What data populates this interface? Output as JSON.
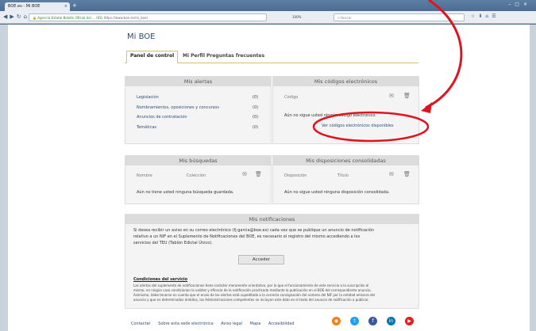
{
  "browser": {
    "tab_title": "BOE.es - Mi BOE",
    "new_tab": "+",
    "url_secure": "Agencia Estatal Boletín Oficial del ... (ES)",
    "url_text": "https://www.boe.es/mi_boe/",
    "zoom": "100%",
    "search_placeholder": "Buscar"
  },
  "page": {
    "title": "Mi BOE",
    "tabs": [
      "Panel de control",
      "Mi Perfil",
      "Preguntas frecuentes"
    ]
  },
  "alertas": {
    "heading": "Mis alertas",
    "items": [
      {
        "label": "Legislación",
        "count": "(0)"
      },
      {
        "label": "Nombramientos, oposiciones y concursos",
        "count": "(0)"
      },
      {
        "label": "Anuncios de contratación",
        "count": "(0)"
      },
      {
        "label": "Temáticas",
        "count": "(0)"
      }
    ]
  },
  "codigos": {
    "heading": "Mis códigos electrónicos",
    "col": "Código",
    "empty": "Aún no sigue usted ningún código electrónico.",
    "link": "Ver códigos electrónicos disponibles"
  },
  "busquedas": {
    "heading": "Mis búsquedas",
    "col1": "Nombre",
    "col2": "Colección",
    "empty": "Aún no tiene usted ninguna búsqueda guardada."
  },
  "disposiciones": {
    "heading": "Mis disposiciones consolidadas",
    "col1": "Disposición",
    "col2": "Título",
    "empty": "Aún no sigue usted ninguna disposición consolidada."
  },
  "notificaciones": {
    "heading": "Mis notificaciones",
    "text1": "Si desea recibir un aviso en su correo electrónico (fj.garcia@boe.es) cada vez que se publique un anuncio de notificación",
    "text2": "relativo a un NIF en el Suplemento de Notificaciones del BOE, es necesario el registro del mismo accediendo a los",
    "text3": "servicios del TEU (Tablón Edictal Único).",
    "button": "Acceder",
    "cond_title": "Condiciones del servicio",
    "cond1": "Las alertas del suplemento de notificaciones tiene carácter meramente orientativo, por lo que el funcionamiento de este servicio o la suscripción al",
    "cond2": "mismo, en ningún caso condicionan la validez y eficacia de la notificación practicada mediante la publicación en el BOE del correspondiente anuncio.",
    "cond3": "Asimismo, debe tenerse en cuenta que el envío de las alertas está supeditado a la correcta consignación del número del NIF por la entidad emisora del",
    "cond4": "anuncio y que en determinados ámbitos, las Administraciones competentes no incluyen este dato en el texto del anuncio de notificación a publicar."
  },
  "footer": {
    "links": [
      "Contactar",
      "Sobre esta sede electrónica",
      "Aviso legal",
      "Mapa",
      "Accesibilidad"
    ]
  },
  "colors": {
    "accent": "#2a4e78",
    "annotation": "#e0141e",
    "tab_border": "#d8c26a"
  }
}
